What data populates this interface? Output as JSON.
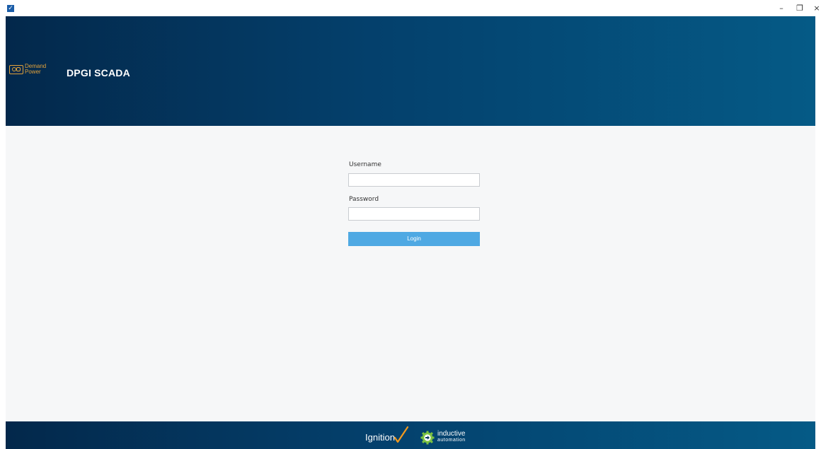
{
  "window": {
    "icon": "checkbox-app-icon",
    "controls": {
      "minimize": "–",
      "maximize": "❐",
      "close": "×"
    }
  },
  "header": {
    "logo_line1": "Demand",
    "logo_line2": "Power",
    "title": "DPGI SCADA"
  },
  "login": {
    "username_label": "Username",
    "username_value": "",
    "password_label": "Password",
    "password_value": "",
    "login_button": "Login"
  },
  "footer": {
    "ignition_text": "Ignition",
    "inductive_line1": "inductive",
    "inductive_line2": "automation"
  },
  "colors": {
    "header_dark": "#03284b",
    "header_light": "#055a86",
    "content_bg": "#f6f7f8",
    "login_button": "#4fa9e3",
    "logo_orange": "#e3a23a",
    "ignition_check": "#f39a1e",
    "ia_gear": "#7cc242"
  }
}
